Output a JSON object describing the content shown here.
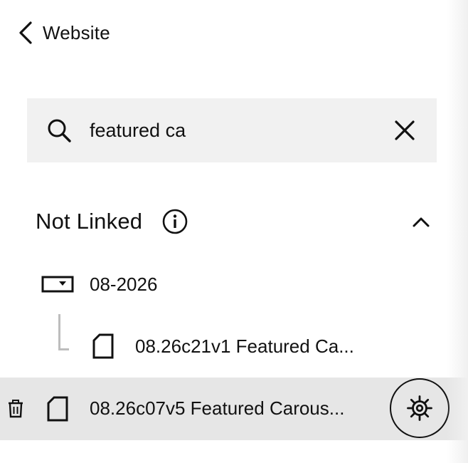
{
  "header": {
    "back_label": "Website",
    "back_icon": "chevron-left-icon"
  },
  "search": {
    "value": "featured ca",
    "placeholder": "",
    "search_icon": "search-icon",
    "clear_icon": "close-icon"
  },
  "section": {
    "title": "Not Linked",
    "info_icon": "info-icon",
    "toggle_icon": "chevron-up-icon",
    "expanded": true
  },
  "tree": {
    "folder": {
      "label": "08-2026",
      "icon": "folder-dropdown-icon"
    },
    "child_page": {
      "label": "08.26c21v1 Featured Ca...",
      "icon": "page-icon"
    },
    "selected_page": {
      "label": "08.26c07v5 Featured Carous...",
      "icon": "page-icon",
      "delete_icon": "trash-icon",
      "settings_icon": "gear-icon"
    }
  },
  "colors": {
    "search_background": "#f1f1f1",
    "selected_row_background": "#e6e6e6",
    "text": "#111111",
    "tree_line": "#bdbdbd"
  }
}
